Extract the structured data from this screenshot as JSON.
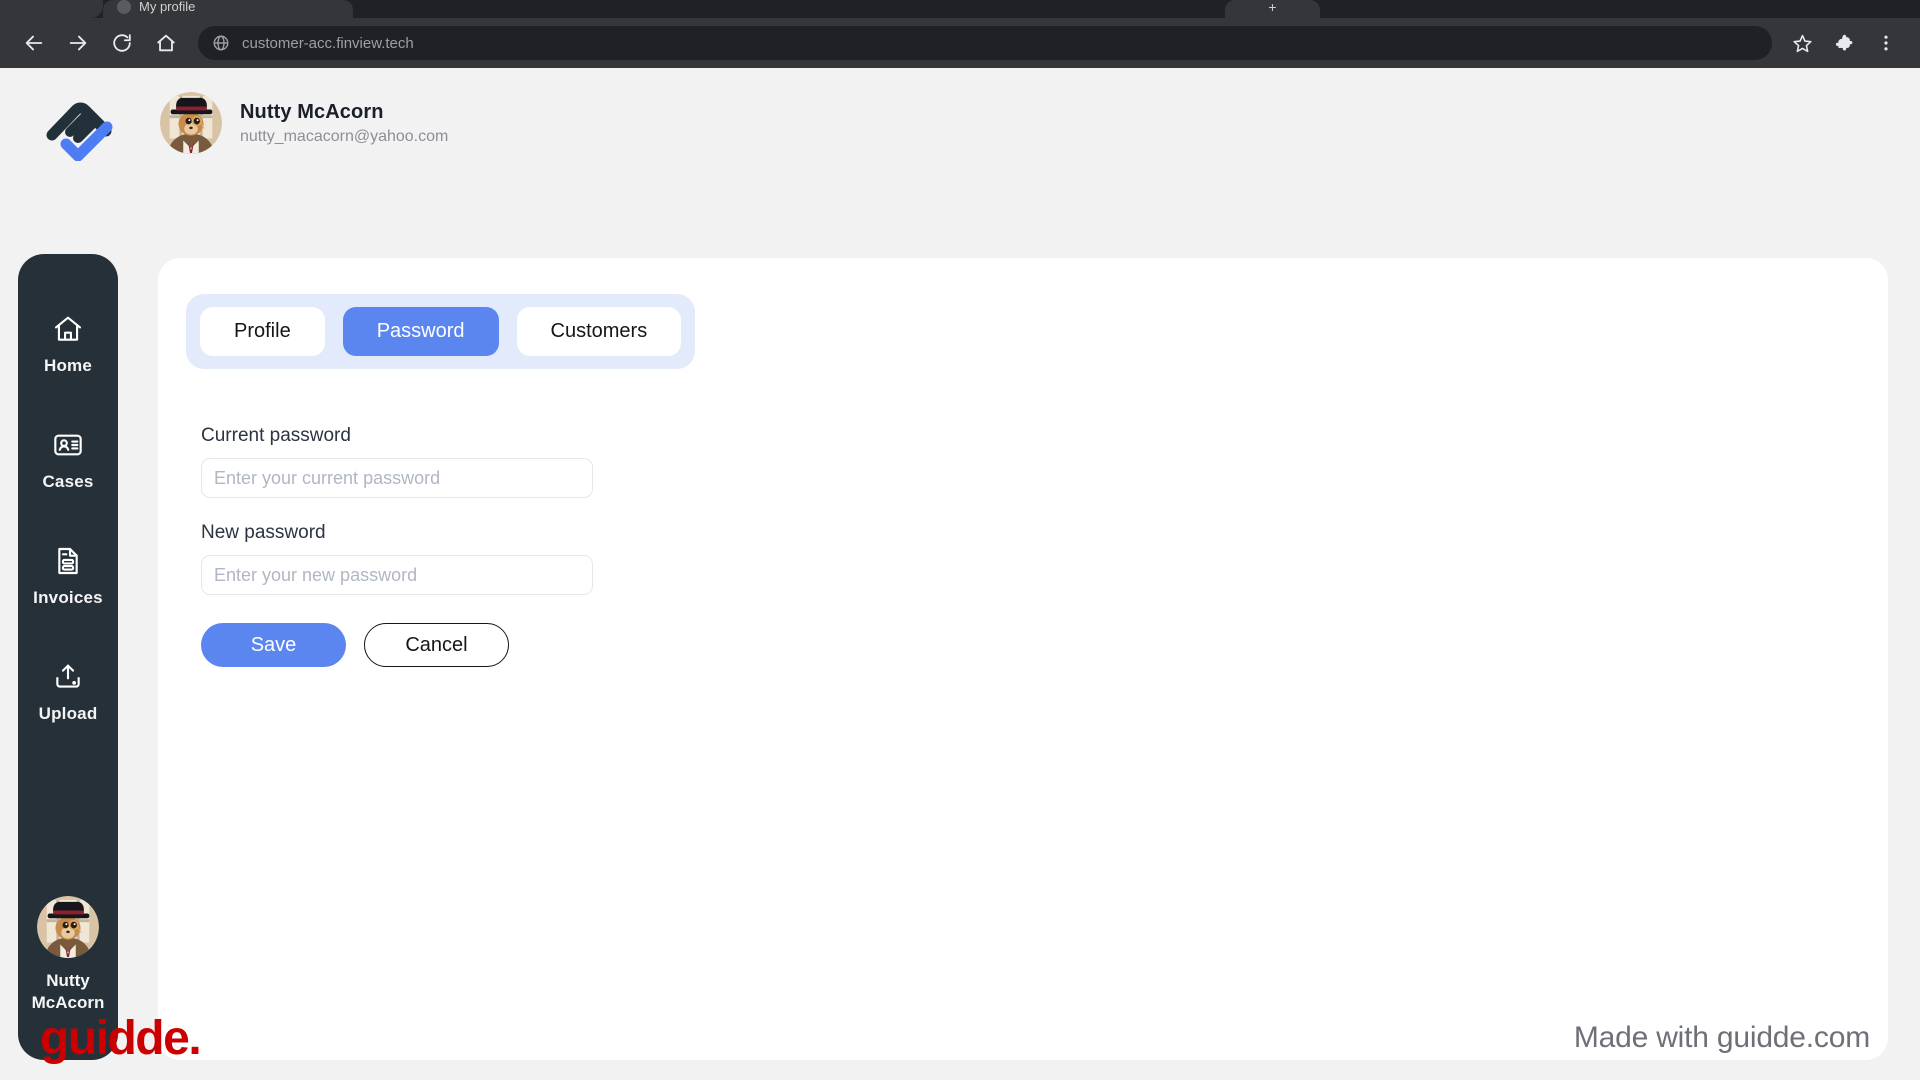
{
  "browser": {
    "tab": {
      "title": "My profile",
      "favicon_icon": "globe-icon"
    },
    "new_tab_label": "+",
    "nav": {
      "back_icon": "arrow-left-icon",
      "forward_icon": "arrow-right-icon",
      "reload_icon": "reload-icon",
      "home_icon": "home-icon"
    },
    "omnibox": {
      "url": "customer-acc.finview.tech",
      "site_icon": "globe-icon"
    },
    "actions": {
      "bookmark_icon": "star-icon",
      "extensions_icon": "puzzle-icon",
      "menu_icon": "three-dots-icon"
    }
  },
  "header": {
    "logo_name": "finview-logo",
    "user": {
      "name": "Nutty McAcorn",
      "email": "nutty_macacorn@yahoo.com",
      "avatar_name": "user-avatar"
    }
  },
  "sidebar": {
    "items": [
      {
        "label": "Home",
        "icon": "home-icon"
      },
      {
        "label": "Cases",
        "icon": "id-card-icon"
      },
      {
        "label": "Invoices",
        "icon": "document-icon"
      },
      {
        "label": "Upload",
        "icon": "upload-icon"
      }
    ],
    "user": {
      "name": "Nutty\nMcAcorn",
      "avatar_name": "user-avatar"
    }
  },
  "main": {
    "tabs": [
      {
        "label": "Profile",
        "active": false
      },
      {
        "label": "Password",
        "active": true
      },
      {
        "label": "Customers",
        "active": false
      }
    ],
    "form": {
      "current_password": {
        "label": "Current password",
        "placeholder": "Enter your current password",
        "value": ""
      },
      "new_password": {
        "label": "New password",
        "placeholder": "Enter your new password",
        "value": ""
      },
      "save_label": "Save",
      "cancel_label": "Cancel"
    }
  },
  "footer": {
    "brand": "guidde.",
    "made_with": "Made with guidde.com"
  },
  "colors": {
    "accent": "#5b86f0",
    "tabs_bg": "#e3eafb",
    "sidebar_bg": "#263038",
    "brand_red": "#cc0000",
    "page_bg": "#f2f2f3"
  }
}
